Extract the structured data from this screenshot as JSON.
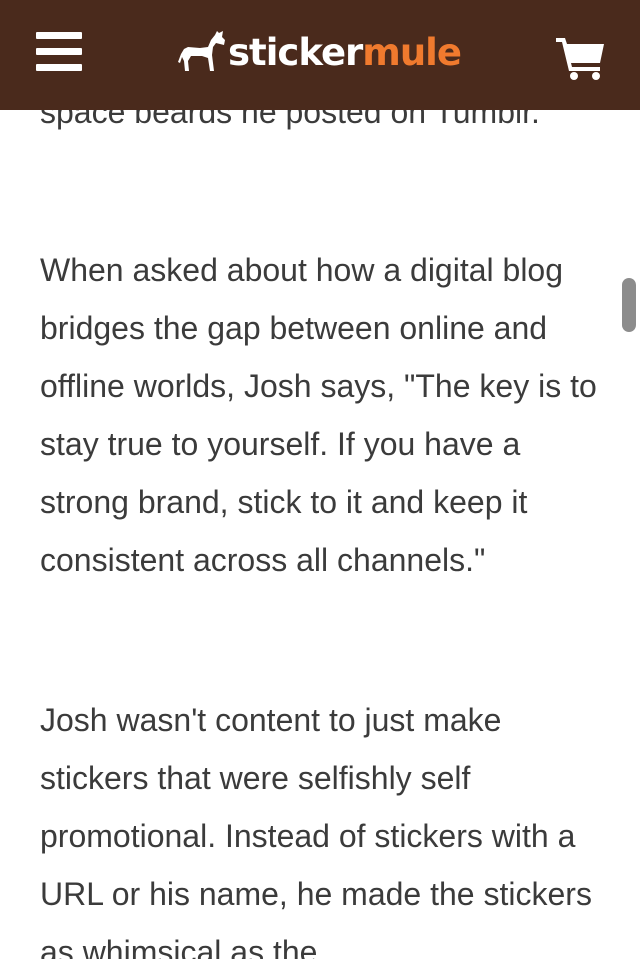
{
  "header": {
    "logo_primary": "sticker",
    "logo_accent": "mule",
    "menu_icon": "hamburger-menu-icon",
    "cart_icon": "shopping-cart-icon"
  },
  "colors": {
    "header_bg": "#4a2a1c",
    "logo_accent": "#f07a2e",
    "body_text": "#3b3b3b"
  },
  "article": {
    "paragraphs": [
      "space beards he posted on Tumblr.",
      "When asked about how a digital blog bridges the gap between online and offline worlds, Josh says, \"The key is to stay true to yourself. If you have a strong brand, stick to it and keep it consistent across all channels.\"",
      "Josh wasn't content to just make stickers that were selfishly self promotional. Instead of stickers with a URL or his name, he made the stickers as whimsical as the"
    ]
  }
}
